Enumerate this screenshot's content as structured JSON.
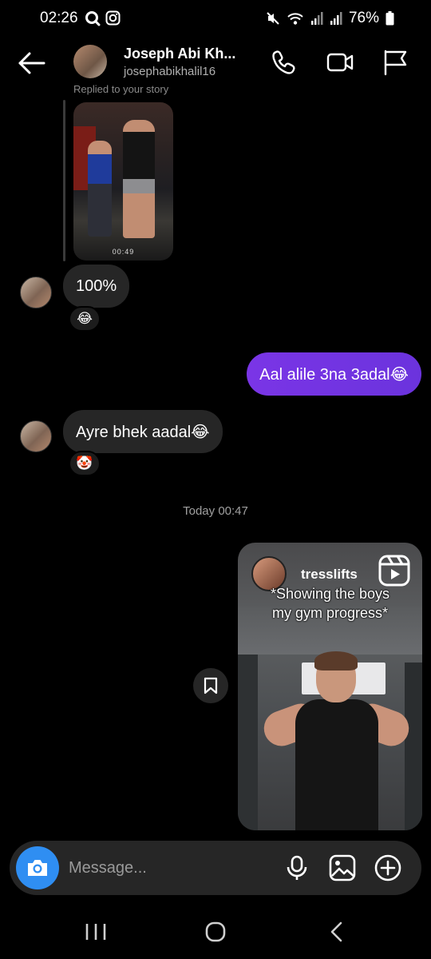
{
  "status_bar": {
    "time": "02:26",
    "battery": "76%",
    "left_icons": [
      "search-status-icon",
      "instagram-status-icon"
    ],
    "right_icons": [
      "mute-icon",
      "wifi-icon",
      "signal-icon",
      "signal-icon-2",
      "battery-icon"
    ]
  },
  "header": {
    "name": "Joseph Abi Kh...",
    "username": "josephabikhalil16",
    "icons": [
      "back-arrow-icon",
      "phone-icon",
      "video-camera-icon",
      "flag-icon"
    ]
  },
  "conversation": {
    "replied_label": "Replied to your story",
    "story_timer": "00:49",
    "messages": [
      {
        "direction": "in",
        "text": "100%",
        "reaction": "😂"
      },
      {
        "direction": "out",
        "text": "Aal alile 3na 3adal😂"
      },
      {
        "direction": "in",
        "text": "Ayre bhek aadal😂",
        "reaction": "🤡"
      }
    ],
    "timestamp": "Today 00:47",
    "reel": {
      "username": "tresslifts",
      "caption_line1": "*Showing the boys",
      "caption_line2": "my gym progress*"
    }
  },
  "composer": {
    "placeholder": "Message...",
    "icons": [
      "camera-icon",
      "microphone-icon",
      "gallery-icon",
      "add-circle-icon"
    ]
  },
  "nav": {
    "icons": [
      "recent-apps-icon",
      "home-icon",
      "back-nav-icon"
    ]
  },
  "colors": {
    "outgoing_bubble": "#6b33dd",
    "incoming_bubble": "#262626",
    "camera_button": "#2f8ef2",
    "background": "#000000"
  }
}
